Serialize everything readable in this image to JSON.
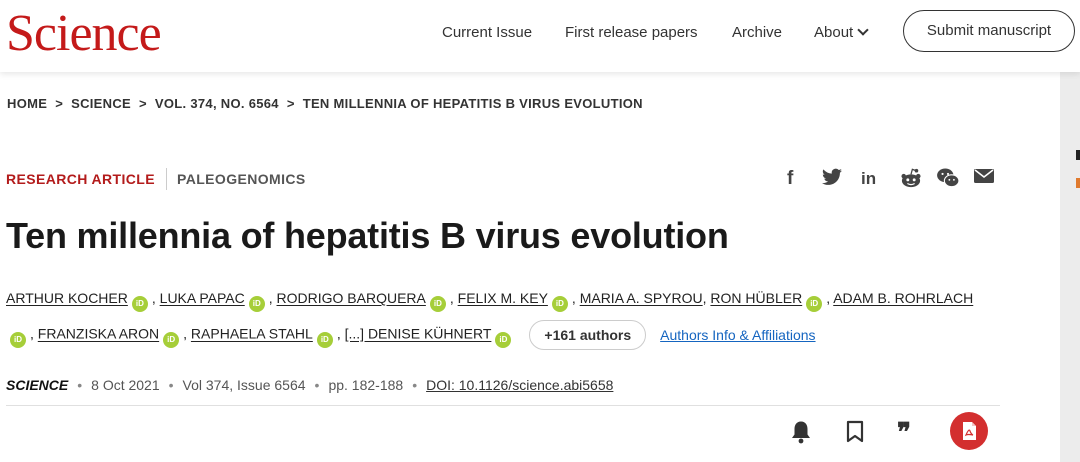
{
  "header": {
    "logo": "Science",
    "nav": {
      "current_issue": "Current Issue",
      "first_release": "First release papers",
      "archive": "Archive",
      "about": "About"
    },
    "submit_label": "Submit manuscript"
  },
  "breadcrumb": {
    "home": "HOME",
    "science": "SCIENCE",
    "issue": "VOL. 374, NO. 6564",
    "current": "TEN MILLENNIA OF HEPATITIS B VIRUS EVOLUTION",
    "separator": ">"
  },
  "article": {
    "type": "RESEARCH ARTICLE",
    "subject": "PALEOGENOMICS",
    "title": "Ten millennia of hepatitis B virus evolution",
    "authors_line1": [
      "ARTHUR KOCHER",
      "LUKA PAPAC",
      "RODRIGO BARQUERA",
      "FELIX M. KEY",
      "MARIA A. SPYROU",
      "RON HÜBLER",
      "ADAM B. ROHRLACH"
    ],
    "authors_line2": [
      "FRANZISKA ARON",
      "RAPHAELA STAHL",
      "[...] DENISE KÜHNERT"
    ],
    "orcid_label": "iD",
    "more_authors": "+161 authors",
    "info_link": "Authors Info & Affiliations"
  },
  "meta": {
    "journal": "SCIENCE",
    "date": "8 Oct 2021",
    "volume": "Vol 374, Issue 6564",
    "pages": "pp. 182-188",
    "doi": "DOI: 10.1126/science.abi5658",
    "bullet": "•"
  },
  "share": {
    "facebook": "f",
    "twitter_icon": "twitter-icon",
    "linkedin": "in",
    "reddit_icon": "reddit-icon",
    "wechat_icon": "wechat-icon",
    "email_icon": "email-icon"
  },
  "tools": {
    "cite": "❞",
    "pdf_icon": "pdf-icon"
  },
  "colors": {
    "brand_red": "#c41a1a",
    "link_blue": "#1565c0",
    "orcid_green": "#a6ce39",
    "pdf_red": "#d32f2f"
  }
}
